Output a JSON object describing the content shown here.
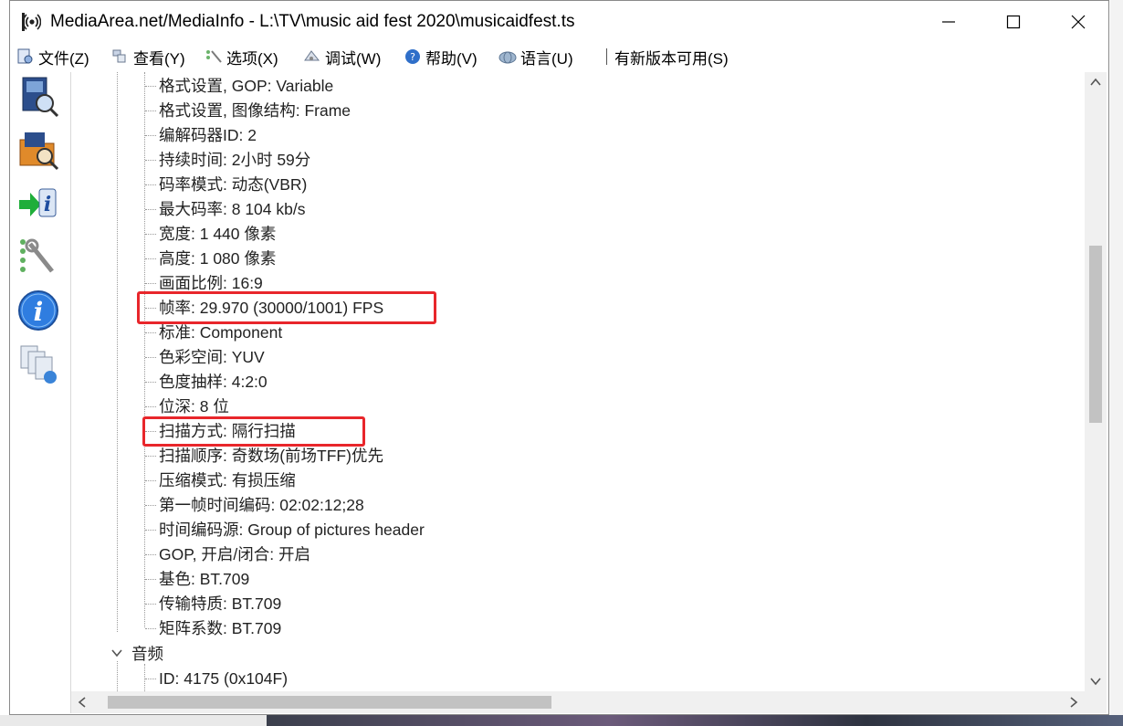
{
  "window": {
    "title": "MediaArea.net/MediaInfo - L:\\TV\\music aid fest 2020\\musicaidfest.ts"
  },
  "menu": {
    "file": "文件(Z)",
    "view": "查看(Y)",
    "options": "选项(X)",
    "debug": "调试(W)",
    "help": "帮助(V)",
    "language": "语言(U)",
    "update": "有新版本可用(S)"
  },
  "toolbar_icons": [
    "open-file-icon",
    "open-folder-icon",
    "export-info-icon",
    "preferences-icon",
    "about-icon",
    "multi-file-icon"
  ],
  "tree": {
    "video_rows": [
      "格式设置, GOP: Variable",
      "格式设置, 图像结构: Frame",
      "编解码器ID: 2",
      "持续时间: 2小时 59分",
      "码率模式: 动态(VBR)",
      "最大码率: 8 104 kb/s",
      "宽度: 1 440 像素",
      "高度: 1 080 像素",
      "画面比例: 16:9",
      "帧率: 29.970 (30000/1001) FPS",
      "标准: Component",
      "色彩空间: YUV",
      "色度抽样: 4:2:0",
      "位深: 8 位",
      "扫描方式: 隔行扫描",
      "扫描顺序: 奇数场(前场TFF)优先",
      "压缩模式: 有损压缩",
      "第一帧时间编码: 02:02:12;28",
      "时间编码源: Group of pictures header",
      "GOP, 开启/闭合: 开启",
      "基色: BT.709",
      "传输特质: BT.709",
      "矩阵系数: BT.709"
    ],
    "audio_node": "音频",
    "audio_rows": [
      "ID: 4175 (0x104F)"
    ],
    "highlighted_rows": [
      "帧率: 29.970 (30000/1001) FPS",
      "扫描方式: 隔行扫描"
    ]
  },
  "colors": {
    "highlight": "#e8262b",
    "scrollbar_thumb": "#c2c2c2",
    "tree_lines": "#9a9a9a"
  }
}
